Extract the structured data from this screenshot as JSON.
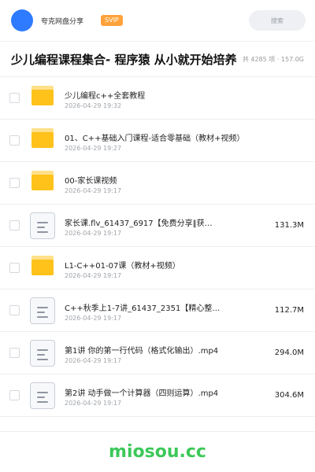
{
  "header": {
    "user_name": "夸克网盘分享",
    "badge": "SVIP",
    "search_placeholder": "搜索"
  },
  "folder": {
    "title": "少儿编程课程集合- 程序猿 从小就开始培养",
    "meta": "共 4285 项 · 157.0G"
  },
  "items": [
    {
      "type": "folder",
      "name": "少儿编程c++全套教程",
      "date": "2026-04-29 19:32",
      "size": ""
    },
    {
      "type": "folder",
      "name": "01、C++基础入门课程-适合零基础（教材+视频）",
      "date": "2026-04-29 19:27",
      "size": ""
    },
    {
      "type": "folder",
      "name": "00-家长课视频",
      "date": "2026-04-29 19:17",
      "size": ""
    },
    {
      "type": "file",
      "name": "家长课.flv_61437_6917【免费分享‖获…",
      "date": "2026-04-29 19:17",
      "size": "131.3M"
    },
    {
      "type": "folder",
      "name": "L1-C++01-07课（教材+视频）",
      "date": "2026-04-29 19:17",
      "size": ""
    },
    {
      "type": "file",
      "name": "C++秋季上1-7讲_61437_2351【精心整…",
      "date": "2026-04-29 19:17",
      "size": "112.7M"
    },
    {
      "type": "file",
      "name": "第1讲 你的第一行代码（格式化输出）.mp4",
      "date": "2026-04-29 19:17",
      "size": "294.0M"
    },
    {
      "type": "file",
      "name": "第2讲 动手做一个计算器（四则运算）.mp4",
      "date": "2026-04-29 19:17",
      "size": "304.6M"
    }
  ],
  "footer": {
    "watermark": "miosou.cc"
  },
  "colors": {
    "avatar": "#2f7bff",
    "badge": "#ffa23a",
    "folder": "#ffc21a",
    "watermark": "#3cc85a"
  }
}
